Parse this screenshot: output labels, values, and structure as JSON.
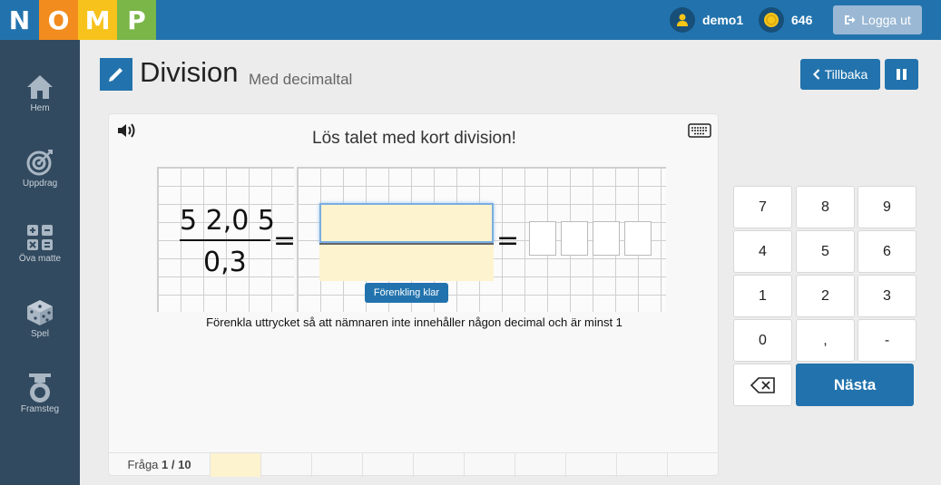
{
  "app": {
    "logo_letters": [
      {
        "char": "N",
        "color": "#2273ad"
      },
      {
        "char": "O",
        "color": "#f28c1e"
      },
      {
        "char": "M",
        "color": "#f7c21b"
      },
      {
        "char": "P",
        "color": "#7ab648"
      }
    ]
  },
  "user": {
    "name": "demo1",
    "coins": "646",
    "logout_label": "Logga ut"
  },
  "sidebar": {
    "items": [
      {
        "label": "Hem",
        "icon": "home-icon"
      },
      {
        "label": "Uppdrag",
        "icon": "target-icon"
      },
      {
        "label": "Öva matte",
        "icon": "calculator-icon"
      },
      {
        "label": "Spel",
        "icon": "dice-icon"
      },
      {
        "label": "Framsteg",
        "icon": "medal-icon"
      }
    ]
  },
  "header": {
    "title": "Division",
    "subtitle": "Med decimaltal",
    "back_label": "Tillbaka",
    "pause_icon": "pause-icon"
  },
  "exercise": {
    "instruction": "Lös talet med kort division!",
    "numerator": "5 2,0 5",
    "denominator": "0,3",
    "equals": "=",
    "done_label": "Förenkling klar",
    "hint": "Förenkla uttrycket så att nämnaren inte innehåller någon decimal och är minst 1",
    "numerator_value": "",
    "denominator_value": "",
    "answer_boxes": [
      "",
      "",
      "",
      ""
    ]
  },
  "progress": {
    "label_prefix": "Fråga ",
    "current": "1 / 10",
    "total_segments": 10,
    "active_segment": 1,
    "active_color": "#fdf3cf"
  },
  "keypad": {
    "keys": [
      "7",
      "8",
      "9",
      "4",
      "5",
      "6",
      "1",
      "2",
      "3",
      "0",
      ",",
      "-"
    ],
    "backspace_icon": "backspace-icon",
    "next_label": "Nästa"
  }
}
